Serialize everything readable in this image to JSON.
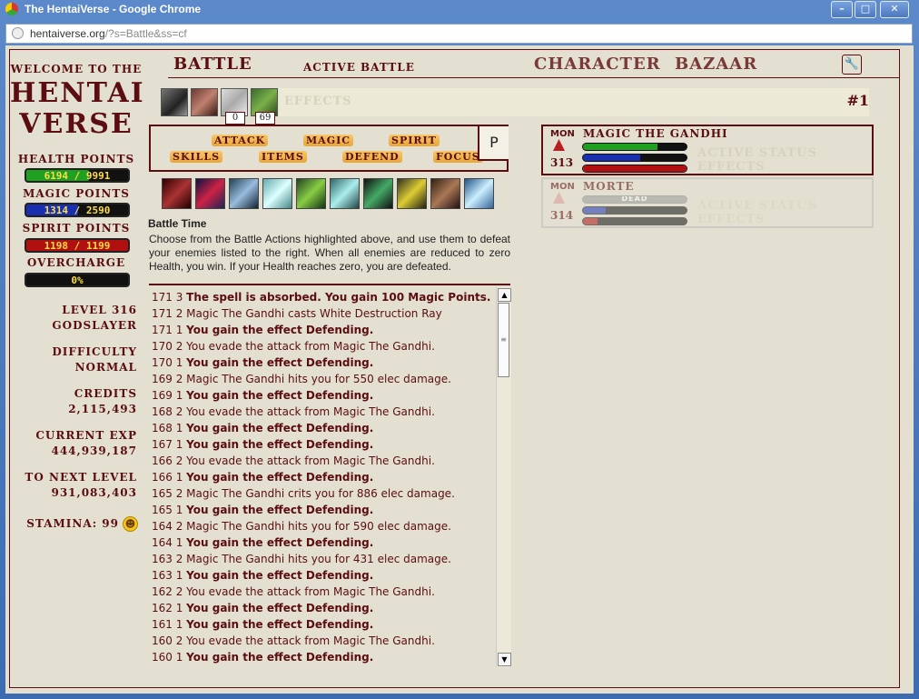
{
  "window": {
    "title": "The HentaiVerse - Google Chrome",
    "url_host": "hentaiverse.org",
    "url_path": "/?s=Battle&ss=cf"
  },
  "sidebar": {
    "welcome": "WELCOME TO THE",
    "logo_line1": "HENTAI",
    "logo_line2": "VERSE",
    "health_label": "HEALTH POINTS",
    "health_value": "6194 / 9991",
    "health_fraction": 0.62,
    "magic_label": "MAGIC POINTS",
    "magic_value": "1314 / 2590",
    "magic_fraction": 0.507,
    "spirit_label": "SPIRIT POINTS",
    "spirit_value": "1198 / 1199",
    "spirit_fraction": 0.999,
    "overcharge_label": "OVERCHARGE",
    "overcharge_value": "0%",
    "level_line1": "LEVEL 316",
    "level_line2": "GODSLAYER",
    "difficulty_label": "DIFFICULTY",
    "difficulty_value": "NORMAL",
    "credits_label": "CREDITS",
    "credits_value": "2,115,493",
    "exp_label": "CURRENT EXP",
    "exp_value": "444,939,187",
    "next_label": "TO NEXT LEVEL",
    "next_value": "931,083,403",
    "stamina": "STAMINA: 99"
  },
  "nav": {
    "battle": "BATTLE",
    "active_battle": "ACTIVE BATTLE",
    "character": "CHARACTER",
    "bazaar": "BAZAAR"
  },
  "effects": {
    "label": "EFFECTS",
    "counter_a": "0",
    "counter_b": "69",
    "round": "#1"
  },
  "actions": {
    "attack": "ATTACK",
    "magic": "MAGIC",
    "spirit": "SPIRIT",
    "skills": "SKILLS",
    "items": "ITEMS",
    "defend": "DEFEND",
    "focus": "FOCUS",
    "p": "P"
  },
  "battle_time": "Battle Time",
  "description": "Choose from the Battle Actions highlighted above, and use them to defeat your enemies listed to the right. When all enemies are reduced to zero Health, you win. If your Health reaches zero, you are defeated.",
  "log": [
    {
      "num": "171 3",
      "text": "The spell is absorbed. You gain 100 Magic Points.",
      "bold": true
    },
    {
      "num": "171 2",
      "text": "Magic The Gandhi casts White Destruction Ray",
      "bold": false
    },
    {
      "num": "171 1",
      "text": "You gain the effect Defending.",
      "bold": true
    },
    {
      "num": "170 2",
      "text": "You evade the attack from Magic The Gandhi.",
      "bold": false
    },
    {
      "num": "170 1",
      "text": "You gain the effect Defending.",
      "bold": true
    },
    {
      "num": "169 2",
      "text": "Magic The Gandhi hits you for 550 elec damage.",
      "bold": false
    },
    {
      "num": "169 1",
      "text": "You gain the effect Defending.",
      "bold": true
    },
    {
      "num": "168 2",
      "text": "You evade the attack from Magic The Gandhi.",
      "bold": false
    },
    {
      "num": "168 1",
      "text": "You gain the effect Defending.",
      "bold": true
    },
    {
      "num": "167 1",
      "text": "You gain the effect Defending.",
      "bold": true
    },
    {
      "num": "166 2",
      "text": "You evade the attack from Magic The Gandhi.",
      "bold": false
    },
    {
      "num": "166 1",
      "text": "You gain the effect Defending.",
      "bold": true
    },
    {
      "num": "165 2",
      "text": "Magic The Gandhi crits you for 886 elec damage.",
      "bold": false
    },
    {
      "num": "165 1",
      "text": "You gain the effect Defending.",
      "bold": true
    },
    {
      "num": "164 2",
      "text": "Magic The Gandhi hits you for 590 elec damage.",
      "bold": false
    },
    {
      "num": "164 1",
      "text": "You gain the effect Defending.",
      "bold": true
    },
    {
      "num": "163 2",
      "text": "Magic The Gandhi hits you for 431 elec damage.",
      "bold": false
    },
    {
      "num": "163 1",
      "text": "You gain the effect Defending.",
      "bold": true
    },
    {
      "num": "162 2",
      "text": "You evade the attack from Magic The Gandhi.",
      "bold": false
    },
    {
      "num": "162 1",
      "text": "You gain the effect Defending.",
      "bold": true
    },
    {
      "num": "161 1",
      "text": "You gain the effect Defending.",
      "bold": true
    },
    {
      "num": "160 2",
      "text": "You evade the attack from Magic The Gandhi.",
      "bold": false
    },
    {
      "num": "160 1",
      "text": "You gain the effect Defending.",
      "bold": true
    }
  ],
  "monsters": [
    {
      "label": "MON",
      "name": "MAGIC THE GANDHI",
      "level": "313",
      "hp": 0.72,
      "mp": 0.55,
      "sp": 1.0,
      "status": "ACTIVE STATUS EFFECTS",
      "dead": ""
    },
    {
      "label": "MON",
      "name": "MORTE",
      "level": "314",
      "hp": 0,
      "mp": 0.22,
      "sp": 0.14,
      "status": "ACTIVE STATUS EFFECTS",
      "dead": "DEAD"
    }
  ],
  "colors": {
    "theme": "#5c0d11",
    "bg": "#e3e0d1",
    "hp": "#20a020",
    "mp": "#1830b0",
    "sp": "#b01010"
  }
}
